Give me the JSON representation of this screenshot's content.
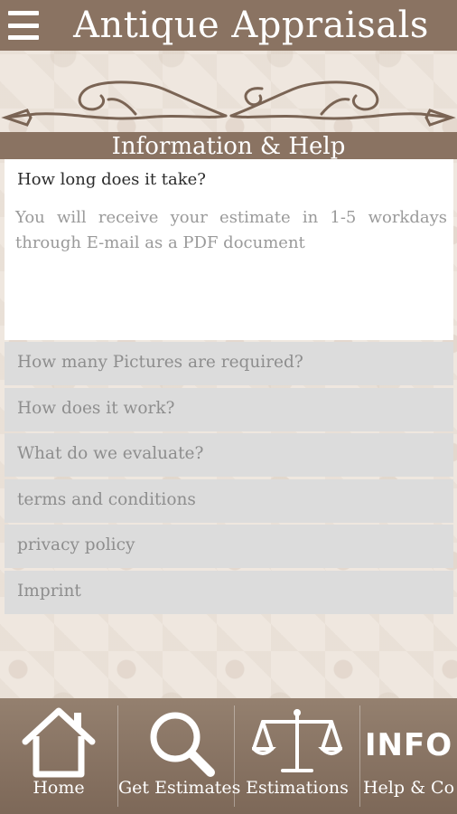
{
  "header": {
    "title": "Antique Appraisals",
    "menu_icon": "hamburger-menu-icon"
  },
  "section": {
    "title": "Information & Help"
  },
  "faq_open": {
    "question": "How long does it take?",
    "answer": "You will receive your estimate in 1-5 workdays through E-mail as a PDF document"
  },
  "faq_items": [
    {
      "label": "How many Pictures are required?"
    },
    {
      "label": "How does it work?"
    },
    {
      "label": "What do we evaluate?"
    },
    {
      "label": "terms and conditions"
    },
    {
      "label": "privacy policy"
    },
    {
      "label": "Imprint"
    }
  ],
  "nav": {
    "home": {
      "label": "Home",
      "icon": "home-icon"
    },
    "get_estimates": {
      "label": "Get Estimates",
      "icon": "search-icon"
    },
    "estimations": {
      "label": "Estimations",
      "icon": "scales-icon"
    },
    "help": {
      "label": "Help & Co",
      "icon_text": "INFO"
    }
  },
  "colors": {
    "brand": "#8a7362",
    "panel": "#ffffff",
    "item_bg": "#dcdcdc",
    "muted_text": "#9a9a9a"
  }
}
